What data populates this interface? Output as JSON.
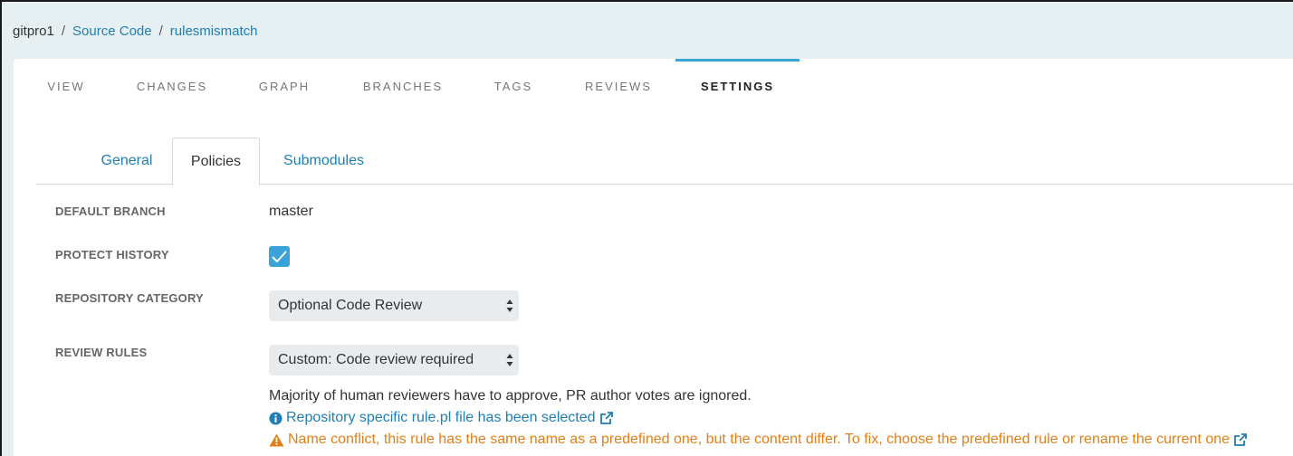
{
  "breadcrumb": {
    "project": "gitpro1",
    "section": "Source Code",
    "repo": "rulesmismatch",
    "separator": "/"
  },
  "main_tabs": [
    {
      "label": "VIEW",
      "active": false
    },
    {
      "label": "CHANGES",
      "active": false
    },
    {
      "label": "GRAPH",
      "active": false
    },
    {
      "label": "BRANCHES",
      "active": false
    },
    {
      "label": "TAGS",
      "active": false
    },
    {
      "label": "REVIEWS",
      "active": false
    },
    {
      "label": "SETTINGS",
      "active": true
    }
  ],
  "sub_tabs": [
    {
      "label": "General",
      "active": false
    },
    {
      "label": "Policies",
      "active": true
    },
    {
      "label": "Submodules",
      "active": false
    }
  ],
  "settings": {
    "default_branch": {
      "label": "DEFAULT BRANCH",
      "value": "master"
    },
    "protect_history": {
      "label": "PROTECT HISTORY",
      "checked": true
    },
    "repository_category": {
      "label": "REPOSITORY CATEGORY",
      "selected": "Optional Code Review"
    },
    "review_rules": {
      "label": "REVIEW RULES",
      "selected": "Custom: Code review required",
      "description": "Majority of human reviewers have to approve, PR author votes are ignored.",
      "info_link": "Repository specific rule.pl file has been selected",
      "warning": "Name conflict, this rule has the same name as a predefined one, but the content differ. To fix, choose the predefined rule or rename the current one"
    }
  },
  "colors": {
    "accent": "#3aa3d8",
    "link": "#1f7fb3",
    "warning": "#e07f1a",
    "background": "#e6eff2"
  },
  "icons": {
    "check": "check-icon",
    "select_arrows": "sort-arrows-icon",
    "info": "info-circle-icon",
    "external": "external-link-icon",
    "warning": "warning-triangle-icon"
  }
}
